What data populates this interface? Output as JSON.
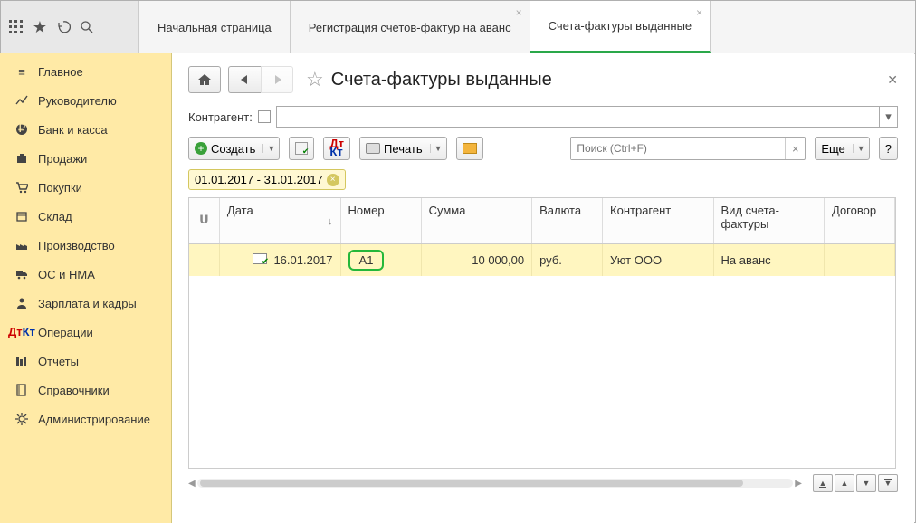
{
  "tabs": [
    {
      "label": "Начальная страница",
      "active": false,
      "closable": false
    },
    {
      "label": "Регистрация счетов-фактур на аванс",
      "active": false,
      "closable": true
    },
    {
      "label": "Счета-фактуры выданные",
      "active": true,
      "closable": true
    }
  ],
  "sidebar": {
    "items": [
      {
        "label": "Главное",
        "icon": "menu-icon"
      },
      {
        "label": "Руководителю",
        "icon": "chart-icon"
      },
      {
        "label": "Банк и касса",
        "icon": "ruble-icon"
      },
      {
        "label": "Продажи",
        "icon": "bag-icon"
      },
      {
        "label": "Покупки",
        "icon": "cart-icon"
      },
      {
        "label": "Склад",
        "icon": "box-icon"
      },
      {
        "label": "Производство",
        "icon": "factory-icon"
      },
      {
        "label": "ОС и НМА",
        "icon": "truck-icon"
      },
      {
        "label": "Зарплата и кадры",
        "icon": "person-icon"
      },
      {
        "label": "Операции",
        "icon": "dtkt-icon"
      },
      {
        "label": "Отчеты",
        "icon": "list-icon"
      },
      {
        "label": "Справочники",
        "icon": "book-icon"
      },
      {
        "label": "Администрирование",
        "icon": "gear-icon"
      }
    ]
  },
  "page": {
    "title": "Счета-фактуры выданные",
    "kontragent_label": "Контрагент:"
  },
  "toolbar": {
    "create": "Создать",
    "print": "Печать",
    "more": "Еще",
    "help": "?",
    "search_placeholder": "Поиск (Ctrl+F)"
  },
  "date_filter": "01.01.2017 - 31.01.2017",
  "grid": {
    "headers": {
      "attach": "",
      "date": "Дата",
      "number": "Номер",
      "sum": "Сумма",
      "currency": "Валюта",
      "kontragent": "Контрагент",
      "type": "Вид счета-фактуры",
      "contract": "Договор"
    },
    "rows": [
      {
        "date": "16.01.2017",
        "number": "А1",
        "sum": "10 000,00",
        "currency": "руб.",
        "kontragent": "Уют ООО",
        "type": "На аванс",
        "contract": ""
      }
    ]
  }
}
